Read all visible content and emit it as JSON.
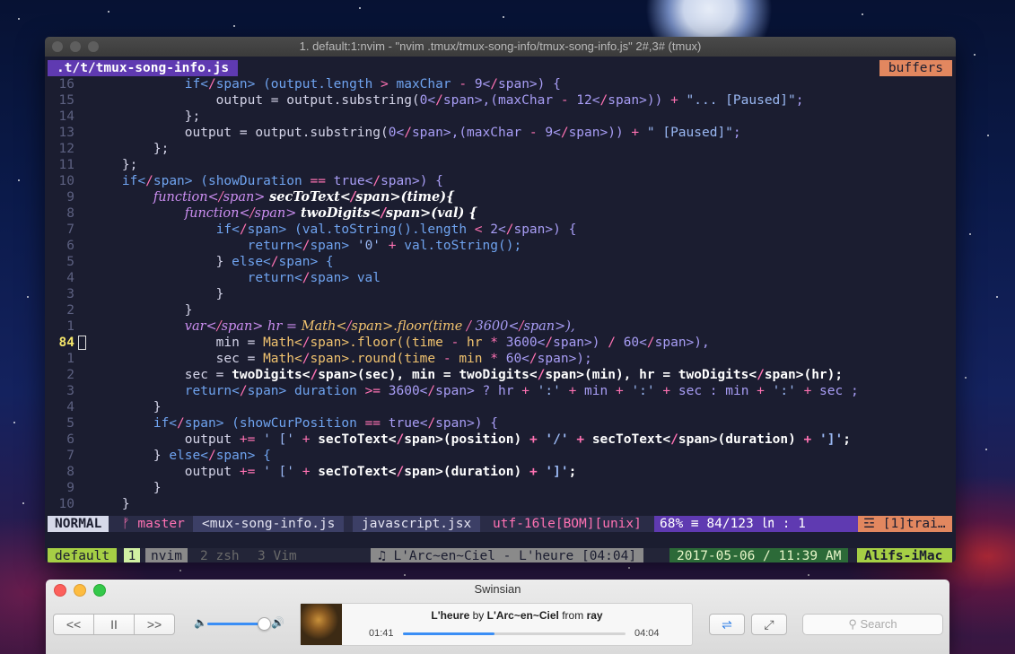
{
  "terminal": {
    "title": "1. default:1:nvim - \"nvim .tmux/tmux-song-info/tmux-song-info.js\" 2#,3# (tmux)",
    "tab_file": ".t/t/tmux-song-info.js",
    "tab_buffers": "buffers",
    "lines": [
      {
        "n": "16",
        "t": "            if (output.length > maxChar - 9) {"
      },
      {
        "n": "15",
        "t": "                output = output.substring(0,(maxChar - 12)) + \"... [Paused]\";"
      },
      {
        "n": "14",
        "t": "            };"
      },
      {
        "n": "13",
        "t": "            output = output.substring(0,(maxChar - 9)) + \" [Paused]\";"
      },
      {
        "n": "12",
        "t": "        };"
      },
      {
        "n": "11",
        "t": "    };"
      },
      {
        "n": "10",
        "t": "    if (showDuration == true) {"
      },
      {
        "n": "9",
        "t": "        function secToText(time){"
      },
      {
        "n": "8",
        "t": "            function twoDigits(val) {"
      },
      {
        "n": "7",
        "t": "                if (val.toString().length < 2) {"
      },
      {
        "n": "6",
        "t": "                    return '0' + val.toString();"
      },
      {
        "n": "5",
        "t": "                } else {"
      },
      {
        "n": "4",
        "t": "                    return val"
      },
      {
        "n": "3",
        "t": "                }"
      },
      {
        "n": "2",
        "t": "            }"
      },
      {
        "n": "1",
        "t": "            var hr = Math.floor(time / 3600),"
      },
      {
        "n": "84",
        "t": "                min = Math.floor((time - hr * 3600) / 60),",
        "current": true
      },
      {
        "n": "1",
        "t": "                sec = Math.round(time - min * 60);"
      },
      {
        "n": "2",
        "t": "            sec = twoDigits(sec), min = twoDigits(min), hr = twoDigits(hr);"
      },
      {
        "n": "3",
        "t": "            return duration >= 3600 ? hr + ':' + min + ':' + sec : min + ':' + sec ;"
      },
      {
        "n": "4",
        "t": "        }"
      },
      {
        "n": "5",
        "t": "        if (showCurPosition == true) {"
      },
      {
        "n": "6",
        "t": "            output += ' [' + secToText(position) + '/' + secToText(duration) + ']';"
      },
      {
        "n": "7",
        "t": "        } else {"
      },
      {
        "n": "8",
        "t": "            output += ' [' + secToText(duration) + ']';"
      },
      {
        "n": "9",
        "t": "        }"
      },
      {
        "n": "10",
        "t": "    }"
      }
    ],
    "status": {
      "mode": "NORMAL",
      "branch": "ᚠ master",
      "file": "<mux-song-info.js",
      "filetype": "javascript.jsx",
      "encoding": "utf-16le[BOM][unix]",
      "position": "68% ≡   84/123 ㏑ :  1",
      "warning": "☲ [1]trai…"
    },
    "tmux": {
      "session": "default",
      "win1_index": "1",
      "win1_name": "nvim",
      "win2": "2 zsh",
      "win3": "3 Vim",
      "song": "♫ L'Arc~en~Ciel - L'heure [04:04]",
      "datetime": "2017-05-06 / 11:39 AM",
      "host": "Alifs-iMac"
    }
  },
  "swinsian": {
    "title": "Swinsian",
    "prev_label": "<<",
    "pause_label": "II",
    "next_label": ">>",
    "volume_level": 0.85,
    "track_title": "L'heure",
    "by_word": "by",
    "artist": "L'Arc~en~Ciel",
    "from_word": "from",
    "album": "ray",
    "elapsed": "01:41",
    "total": "04:04",
    "progress": 0.41,
    "search_placeholder": "Search",
    "icons": [
      "volume-low-icon",
      "volume-high-icon",
      "shuffle-icon",
      "miniplayer-icon",
      "search-icon",
      "album-art"
    ]
  }
}
